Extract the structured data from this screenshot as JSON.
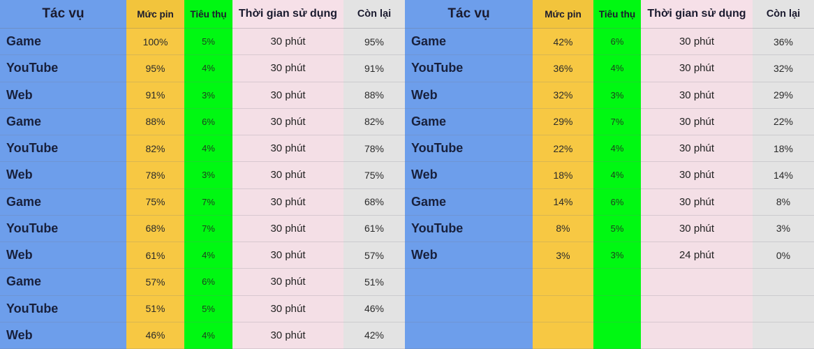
{
  "colors": {
    "task_bg": "#6d9eeb",
    "battery_bg": "#f7c843",
    "consumption_bg": "#00f812",
    "time_bg": "#f4dfe6",
    "remaining_bg": "#e3e3e3",
    "text": "#1a1a2e"
  },
  "tables": [
    {
      "id": "left-table",
      "headers": {
        "task": "Tác vụ",
        "battery": "Mức pin",
        "consumption": "Tiêu thụ",
        "time": "Thời gian sử dụng",
        "remaining": "Còn lại"
      },
      "rows": [
        {
          "task": "Game",
          "battery": "100%",
          "consumption": "5%",
          "time": "30 phút",
          "remaining": "95%"
        },
        {
          "task": "YouTube",
          "battery": "95%",
          "consumption": "4%",
          "time": "30 phút",
          "remaining": "91%"
        },
        {
          "task": "Web",
          "battery": "91%",
          "consumption": "3%",
          "time": "30 phút",
          "remaining": "88%"
        },
        {
          "task": "Game",
          "battery": "88%",
          "consumption": "6%",
          "time": "30 phút",
          "remaining": "82%"
        },
        {
          "task": "YouTube",
          "battery": "82%",
          "consumption": "4%",
          "time": "30 phút",
          "remaining": "78%"
        },
        {
          "task": "Web",
          "battery": "78%",
          "consumption": "3%",
          "time": "30 phút",
          "remaining": "75%"
        },
        {
          "task": "Game",
          "battery": "75%",
          "consumption": "7%",
          "time": "30 phút",
          "remaining": "68%"
        },
        {
          "task": "YouTube",
          "battery": "68%",
          "consumption": "7%",
          "time": "30 phút",
          "remaining": "61%"
        },
        {
          "task": "Web",
          "battery": "61%",
          "consumption": "4%",
          "time": "30 phút",
          "remaining": "57%"
        },
        {
          "task": "Game",
          "battery": "57%",
          "consumption": "6%",
          "time": "30 phút",
          "remaining": "51%"
        },
        {
          "task": "YouTube",
          "battery": "51%",
          "consumption": "5%",
          "time": "30 phút",
          "remaining": "46%"
        },
        {
          "task": "Web",
          "battery": "46%",
          "consumption": "4%",
          "time": "30 phút",
          "remaining": "42%"
        }
      ]
    },
    {
      "id": "right-table",
      "headers": {
        "task": "Tác vụ",
        "battery": "Mức pin",
        "consumption": "Tiêu thụ",
        "time": "Thời gian sử dụng",
        "remaining": "Còn lại"
      },
      "rows": [
        {
          "task": "Game",
          "battery": "42%",
          "consumption": "6%",
          "time": "30 phút",
          "remaining": "36%"
        },
        {
          "task": "YouTube",
          "battery": "36%",
          "consumption": "4%",
          "time": "30 phút",
          "remaining": "32%"
        },
        {
          "task": "Web",
          "battery": "32%",
          "consumption": "3%",
          "time": "30 phút",
          "remaining": "29%"
        },
        {
          "task": "Game",
          "battery": "29%",
          "consumption": "7%",
          "time": "30 phút",
          "remaining": "22%"
        },
        {
          "task": "YouTube",
          "battery": "22%",
          "consumption": "4%",
          "time": "30 phút",
          "remaining": "18%"
        },
        {
          "task": "Web",
          "battery": "18%",
          "consumption": "4%",
          "time": "30 phút",
          "remaining": "14%"
        },
        {
          "task": "Game",
          "battery": "14%",
          "consumption": "6%",
          "time": "30 phút",
          "remaining": "8%"
        },
        {
          "task": "YouTube",
          "battery": "8%",
          "consumption": "5%",
          "time": "30 phút",
          "remaining": "3%"
        },
        {
          "task": "Web",
          "battery": "3%",
          "consumption": "3%",
          "time": "24 phút",
          "remaining": "0%"
        },
        {
          "task": "",
          "battery": "",
          "consumption": "",
          "time": "",
          "remaining": ""
        },
        {
          "task": "",
          "battery": "",
          "consumption": "",
          "time": "",
          "remaining": ""
        },
        {
          "task": "",
          "battery": "",
          "consumption": "",
          "time": "",
          "remaining": ""
        }
      ]
    }
  ]
}
